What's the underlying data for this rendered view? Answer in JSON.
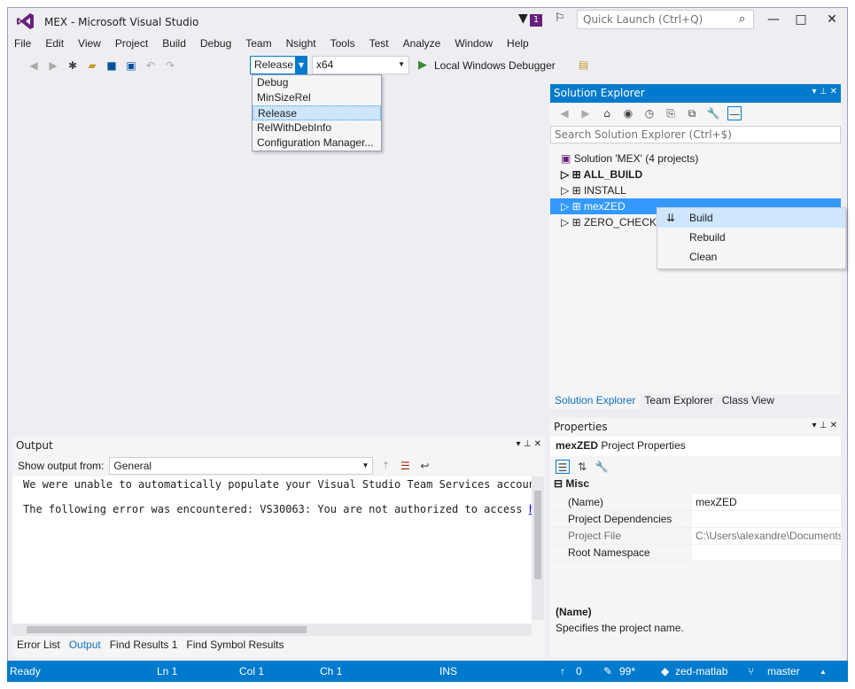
{
  "window": {
    "title": "MEX - Microsoft Visual Studio",
    "notification_count": "1",
    "quick_launch_placeholder": "Quick Launch (Ctrl+Q)"
  },
  "menu": [
    "File",
    "Edit",
    "View",
    "Project",
    "Build",
    "Debug",
    "Team",
    "Nsight",
    "Tools",
    "Test",
    "Analyze",
    "Window",
    "Help"
  ],
  "toolbar": {
    "config": "Release",
    "platform": "x64",
    "debugger": "Local Windows Debugger"
  },
  "config_dropdown": [
    "Debug",
    "MinSizeRel",
    "Release",
    "RelWithDebInfo",
    "Configuration Manager..."
  ],
  "solution_explorer": {
    "title": "Solution Explorer",
    "search_placeholder": "Search Solution Explorer (Ctrl+$)",
    "solution": "Solution 'MEX' (4 projects)",
    "projects": [
      "ALL_BUILD",
      "INSTALL",
      "mexZED",
      "ZERO_CHECK"
    ],
    "tabs": [
      "Solution Explorer",
      "Team Explorer",
      "Class View"
    ]
  },
  "context_menu": [
    "Build",
    "Rebuild",
    "Clean"
  ],
  "properties": {
    "title": "Properties",
    "object": "mexZED",
    "object_type": "Project Properties",
    "category": "Misc",
    "rows": [
      {
        "k": "(Name)",
        "v": "mexZED"
      },
      {
        "k": "Project Dependencies",
        "v": ""
      },
      {
        "k": "Project File",
        "v": "C:\\Users\\alexandre\\Documents"
      },
      {
        "k": "Root Namespace",
        "v": ""
      }
    ],
    "desc_title": "(Name)",
    "desc": "Specifies the project name."
  },
  "output": {
    "title": "Output",
    "show_from_label": "Show output from:",
    "source": "General",
    "line1": "We were unable to automatically populate your Visual Studio Team Services accounts",
    "line2": "The following error was encountered: VS30063: You are not authorized to access ",
    "link": "htt",
    "tabs": [
      "Error List",
      "Output",
      "Find Results 1",
      "Find Symbol Results"
    ]
  },
  "status": {
    "state": "Ready",
    "ln": "Ln 1",
    "col": "Col 1",
    "ch": "Ch 1",
    "ins": "INS",
    "up": "0",
    "edits": "99*",
    "repo": "zed-matlab",
    "branch": "master"
  },
  "colors": {
    "accent": "#007acc",
    "vs_purple": "#68217a"
  }
}
